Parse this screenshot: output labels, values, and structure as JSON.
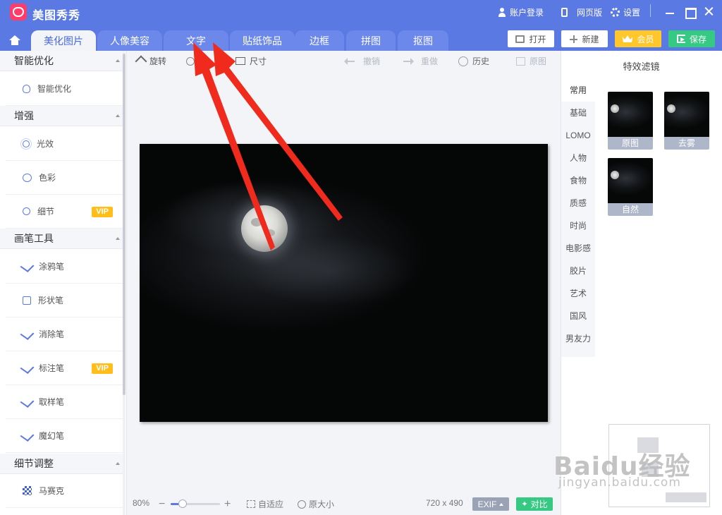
{
  "app": {
    "title": "美图秀秀"
  },
  "titlebar": {
    "account_login": "账户登录",
    "web_version": "网页版",
    "settings": "设置"
  },
  "tabs": [
    "美化图片",
    "人像美容",
    "文字",
    "贴纸饰品",
    "边框",
    "拼图",
    "抠图"
  ],
  "active_tab": "美化图片",
  "actions": {
    "open": "打开",
    "new": "新建",
    "vip": "会员",
    "save": "保存"
  },
  "sidebar": {
    "sections": [
      {
        "title": "智能优化",
        "items": [
          {
            "label": "智能优化",
            "icon": "bulb-icon"
          }
        ]
      },
      {
        "title": "增强",
        "items": [
          {
            "label": "光效",
            "icon": "sun-icon"
          },
          {
            "label": "色彩",
            "icon": "palette-icon"
          },
          {
            "label": "细节",
            "icon": "magnify-icon",
            "badge": "VIP"
          }
        ]
      },
      {
        "title": "画笔工具",
        "items": [
          {
            "label": "涂鸦笔",
            "icon": "brush-icon"
          },
          {
            "label": "形状笔",
            "icon": "shapes-icon"
          },
          {
            "label": "消除笔",
            "icon": "eraser-icon"
          },
          {
            "label": "标注笔",
            "icon": "marker-icon",
            "badge": "VIP"
          },
          {
            "label": "取样笔",
            "icon": "eyedropper-icon"
          },
          {
            "label": "魔幻笔",
            "icon": "magic-wand-icon"
          }
        ]
      },
      {
        "title": "细节调整",
        "items": [
          {
            "label": "马赛克",
            "icon": "mosaic-icon"
          }
        ]
      }
    ]
  },
  "toolbar": {
    "rotate": "旋转",
    "crop_partial": "剪",
    "size": "尺寸",
    "undo": "撤销",
    "redo": "重做",
    "history": "历史",
    "original": "原图"
  },
  "statusbar": {
    "zoom": "80%",
    "zoom_fraction": 0.24,
    "fit": "自适应",
    "actual_size": "原大小",
    "dimensions": "720 x 490",
    "exif": "EXIF",
    "compare": "对比"
  },
  "filters": {
    "title": "特效滤镜",
    "categories": [
      "常用",
      "基础",
      "LOMO",
      "人物",
      "食物",
      "质感",
      "时尚",
      "电影感",
      "胶片",
      "艺术",
      "国风",
      "男友力"
    ],
    "active_category": "常用",
    "thumbnails": [
      "原图",
      "去雾",
      "自然"
    ]
  },
  "watermark": {
    "main": "Baidu经验",
    "sub": "jingyan.baidu.com"
  },
  "colors": {
    "titlebar": "#5b79e3",
    "accent": "#4669e0",
    "vip_badge": "#ffbe1a",
    "save": "#35c983",
    "arrow": "#f02a1c"
  }
}
